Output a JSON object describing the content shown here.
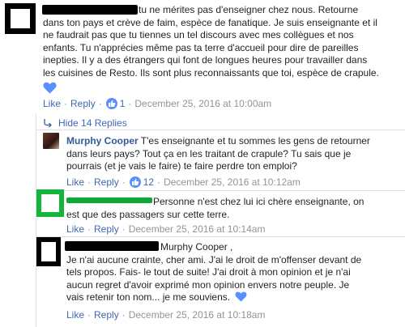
{
  "comments": [
    {
      "author": "",
      "text_lines": [
        "tu ne mérites pas d'enseigner chez nous. Retourne",
        "dans ton pays et crève de faim, espèce de fanatique. Je suis enseignante et il",
        "ne faudrait pas que tu tiennes un tel discours avec mes collègues et nos",
        "enfants. Tu n'apprécies même pas ta terre d'accueil pour dire de pareilles",
        "inepties. Il y a des étrangers qui font de longues heures pour travailler dans",
        "les cuisines de Resto. Ils sont plus reconnaissants que toi, espèce de crapule."
      ],
      "reaction": "heart-icon",
      "actions": {
        "like": "Like",
        "reply": "Reply",
        "like_count": "1",
        "timestamp": "December 25, 2016 at 10:00am"
      }
    },
    {
      "author": "Murphy Cooper",
      "text_lines": [
        "T'es enseignante et tu sommes les gens de retourner",
        "dans leurs pays? Tout ça en les traitant de crapule? Tu sais que je",
        "pourrais (et je vais le faire) te faire perdre ton emploi?"
      ],
      "actions": {
        "like": "Like",
        "reply": "Reply",
        "like_count": "12",
        "timestamp": "December 25, 2016 at 10:12am"
      }
    },
    {
      "author": "",
      "text_lines": [
        "Personne n'est chez lui ici chère enseignante, on",
        "est que des passagers sur cette terre."
      ],
      "actions": {
        "like": "Like",
        "reply": "Reply",
        "timestamp": "December 25, 2016 at 10:14am"
      }
    },
    {
      "author": "",
      "mention": "Murphy Cooper ,",
      "text_lines": [
        "Je n'ai aucune crainte, cher ami. J'ai le droit de m'offenser devant de",
        "tels propos. Fais- le tout de suite! J'ai droit à mon opinion et je n'ai",
        "aucun regret d'avoir exprimé mon opinion envers notre peuple. Je",
        "vais retenir ton nom... je me souviens."
      ],
      "reaction": "heart-icon",
      "actions": {
        "like": "Like",
        "reply": "Reply",
        "timestamp": "December 25, 2016 at 10:18am"
      }
    }
  ],
  "hide_replies_label": "Hide 14 Replies",
  "colors": {
    "link": "#4267b2",
    "name": "#365899",
    "meta": "#90949c",
    "heart": "#5890ff",
    "green_highlight": "#13b53b"
  }
}
